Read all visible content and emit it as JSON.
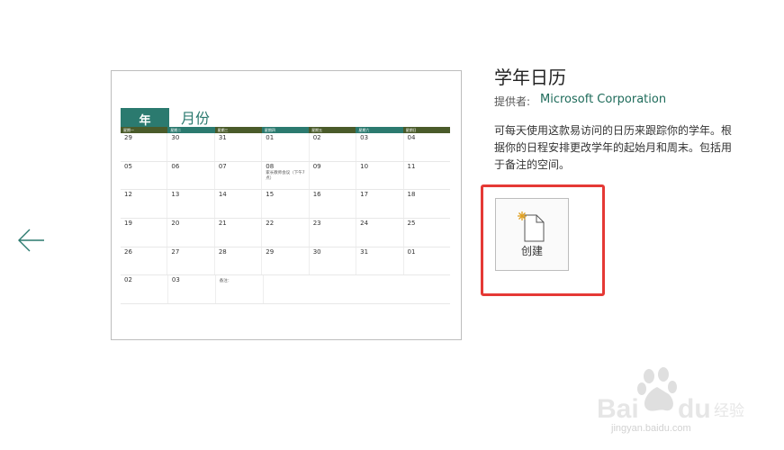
{
  "preview": {
    "year_label": "年",
    "month_label": "月份",
    "weekdays": [
      "星期一",
      "星期二",
      "星期三",
      "星期四",
      "星期五",
      "星期六",
      "星期日"
    ],
    "weekday_colors": [
      "#4a5b2a",
      "#2b7a6f",
      "#4a5b2a",
      "#2b7a6f",
      "#4a5b2a",
      "#2b7a6f",
      "#4a5b2a"
    ],
    "weeks": [
      [
        "29",
        "30",
        "31",
        "01",
        "02",
        "03",
        "04"
      ],
      [
        "05",
        "06",
        "07",
        "08",
        "09",
        "10",
        "11"
      ],
      [
        "12",
        "13",
        "14",
        "15",
        "16",
        "17",
        "18"
      ],
      [
        "19",
        "20",
        "21",
        "22",
        "23",
        "24",
        "25"
      ],
      [
        "26",
        "27",
        "28",
        "29",
        "30",
        "31",
        "01"
      ],
      [
        "02",
        "03",
        "",
        "",
        "",
        "",
        ""
      ]
    ],
    "event_note": "家长教师会议（下午7点）",
    "notes_label": "备注："
  },
  "panel": {
    "title": "学年日历",
    "provider_label": "提供者:",
    "provider_name": "Microsoft Corporation",
    "description": "可每天使用这款易访问的日历来跟踪你的学年。根据你的日程安排更改学年的起始月和周末。包括用于备注的空间。",
    "create_label": "创建"
  },
  "watermark": {
    "brand": "Baidu经验",
    "url": "jingyan.baidu.com"
  },
  "colors": {
    "accent": "#2b7a6f",
    "provider": "#1e6b5a",
    "highlight": "#e53935",
    "olive": "#4a5b2a"
  }
}
